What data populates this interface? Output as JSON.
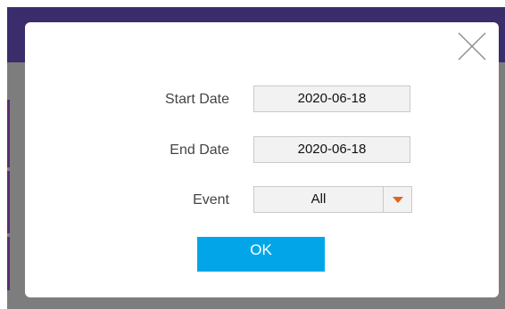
{
  "dialog": {
    "close_icon": "close-icon",
    "start_date": {
      "label": "Start Date",
      "value": "2020-06-18"
    },
    "end_date": {
      "label": "End Date",
      "value": "2020-06-18"
    },
    "event": {
      "label": "Event",
      "value": "All",
      "dropdown_icon": "chevron-down-icon"
    },
    "ok_label": "OK"
  },
  "colors": {
    "header": "#3b2c6b",
    "overlay": "#7d7d7d",
    "ok_button": "#02a6e8",
    "dropdown_arrow": "#e0641e"
  }
}
